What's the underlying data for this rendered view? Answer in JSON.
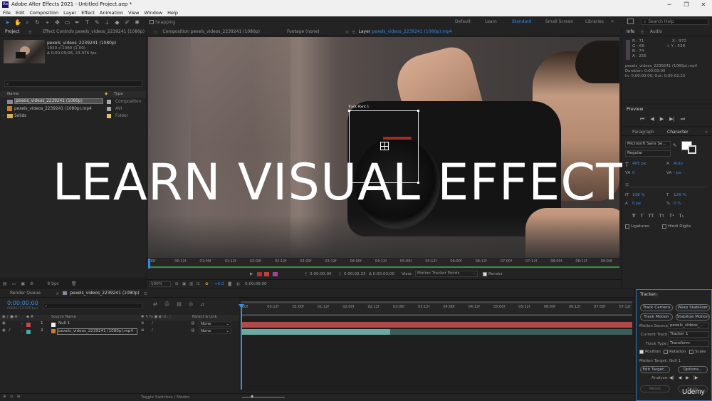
{
  "title": "Adobe After Effects 2021 - Untitled Project.aep *",
  "app_icon": "Ae",
  "menu": [
    "File",
    "Edit",
    "Composition",
    "Layer",
    "Effect",
    "Animation",
    "View",
    "Window",
    "Help"
  ],
  "toolbar": {
    "snapping": "Snapping"
  },
  "workspaces": [
    "Default",
    "Learn",
    "Standard",
    "Small Screen",
    "Libraries"
  ],
  "active_workspace": "Standard",
  "search_help": "Search Help",
  "project": {
    "tab": "Project",
    "effect_controls": "Effect Controls pexels_videos_2239241 (1080p)",
    "thumb_name": "pexels_videos_2239241 (1080p)",
    "thumb_res": "1920 x 1080 (1.00)",
    "thumb_dur": "Δ 0;00;09;06, 23.976 fps",
    "col_name": "Name",
    "col_type": "Type",
    "items": [
      {
        "name": "pexels_videos_2239241 (1080p)",
        "type": "Composition",
        "color": "#a9a9a9"
      },
      {
        "name": "pexels_videos_2239241 (1080p).mp4",
        "type": "AVI",
        "color": "#a9a9a9"
      },
      {
        "name": "Solids",
        "type": "Folder",
        "color": "#e0c060"
      }
    ],
    "bpc": "8 bpc"
  },
  "viewer": {
    "tabs": {
      "composition": "Composition pexels_videos_2239241 (1080p)",
      "footage": "Footage (none)",
      "layer_prefix": "Layer",
      "layer_name": "pexels_videos_2239241 (1080p).mp4"
    },
    "track_point": "Track Point 1",
    "overlay_text": "LEARN VISUAL EFFECTS",
    "ruler": [
      "00f",
      "00:12f",
      "01:00f",
      "01:12f",
      "02:00f",
      "02:12f",
      "03:00f",
      "03:12f",
      "04:00f",
      "04:12f",
      "05:00f",
      "05:12f",
      "06:00f",
      "06:12f",
      "07:00f",
      "07:12f",
      "08:00f",
      "08:12f",
      "09:00f"
    ],
    "in_time": "0:00:00:00",
    "dur_time": "0:00:02:23",
    "out_time": "Δ 0:00:03:00",
    "view_label": "View:",
    "view_value": "Motion Tracker Points",
    "render": "Render",
    "zoom": "100%",
    "exposure": "+0.0",
    "current_time": "0:00:00:00"
  },
  "info": {
    "tab": "Info",
    "audio": "Audio",
    "rgba": [
      "R : 71",
      "G : 66",
      "B : 74",
      "A : 255"
    ],
    "x": "X : 972",
    "y": "+ Y : 538",
    "details": [
      "pexels_videos_2239241 (1080p).mp4",
      "Duration: 0:00:03:00",
      "In: 0:00:00:00, Out: 0:00:02:23"
    ]
  },
  "preview": {
    "tab": "Preview"
  },
  "character": {
    "tab_paragraph": "Paragraph",
    "tab_character": "Character",
    "font": "Microsoft Sans Se...",
    "style": "Regular",
    "size": "405 px",
    "leading": "Auto",
    "kerning": "0",
    "tracking": "- px",
    "vscale": "138 %",
    "hscale": "129 %",
    "baseline": "0 px",
    "tsume": "0 %",
    "styles": [
      "T",
      "T",
      "TT",
      "Tт",
      "T¹",
      "T₁"
    ],
    "ligatures": "Ligatures",
    "hindi": "Hindi Digits"
  },
  "timeline": {
    "render_queue": "Render Queue",
    "comp_tab": "pexels_videos_2239241 (1080p)",
    "timecode": "0:00:00:00",
    "frames": "00000 (23.976 fps)",
    "col_source": "Source Name",
    "col_parent": "Parent & Link",
    "layers": [
      {
        "num": "1",
        "name": "Null 1",
        "parent": "None",
        "color": "#c44"
      },
      {
        "num": "2",
        "name": "pexels_videos_2239241 (1080p).mp4",
        "parent": "None",
        "color": "#4aa"
      }
    ],
    "ruler": [
      "00f",
      "00:12f",
      "01:00f",
      "01:12f",
      "02:00f",
      "02:12f",
      "03:00f",
      "03:12f",
      "04:00f",
      "04:12f",
      "05:00f",
      "05:12f",
      "06:00f",
      "06:12f",
      "07:00f",
      "07:12f"
    ],
    "toggle": "Toggle Switches / Modes"
  },
  "tracker": {
    "tab": "Tracker",
    "track_camera": "Track Camera",
    "warp_stabilizer": "Warp Stabilizer",
    "track_motion": "Track Motion",
    "stabilize_motion": "Stabilize Motion",
    "motion_source_label": "Motion Source:",
    "motion_source": "pexels_videos_...",
    "current_track_label": "Current Track:",
    "current_track": "Tracker 1",
    "track_type_label": "Track Type:",
    "track_type": "Transform",
    "position": "Position",
    "rotation": "Rotation",
    "scale": "Scale",
    "motion_target_label": "Motion Target:",
    "motion_target": "Null 1",
    "edit_target": "Edit Target...",
    "options": "Options...",
    "analyze": "Analyze:",
    "reset": "Reset",
    "apply": "Apply"
  },
  "watermark": "Udemy"
}
